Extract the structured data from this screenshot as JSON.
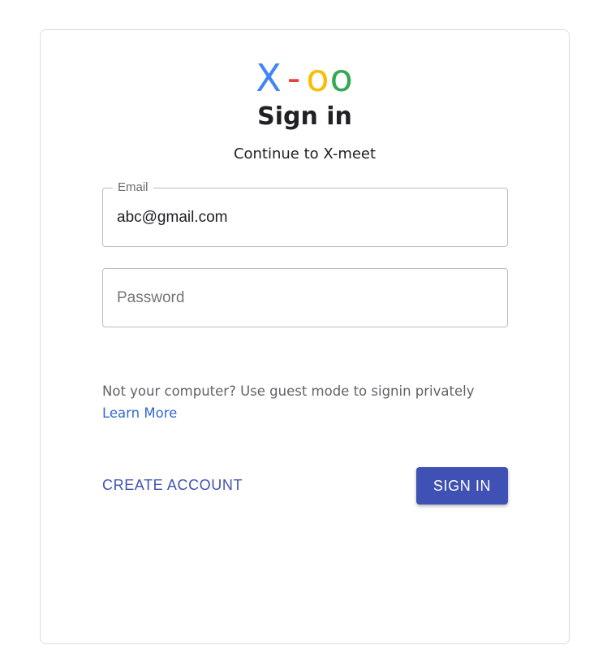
{
  "logo": {
    "x": "X",
    "dash": "-",
    "o1": "o",
    "o2": "o",
    "colors": {
      "x": "#4285f4",
      "dash": "#ea4335",
      "o1": "#fbbc05",
      "o2": "#34a853"
    }
  },
  "header": {
    "title": "Sign in",
    "subtitle": "Continue to X-meet"
  },
  "form": {
    "email": {
      "label": "Email",
      "value": "abc@gmail.com"
    },
    "password": {
      "placeholder": "Password",
      "value": ""
    }
  },
  "notice": {
    "text": "Not your computer? Use guest mode to signin privately",
    "link_label": "Learn More"
  },
  "actions": {
    "create_account_label": "CREATE ACCOUNT",
    "sign_in_label": "SIGN IN"
  },
  "colors": {
    "primary": "#3f51b5",
    "link": "#3367d6",
    "border": "#dadce0"
  }
}
